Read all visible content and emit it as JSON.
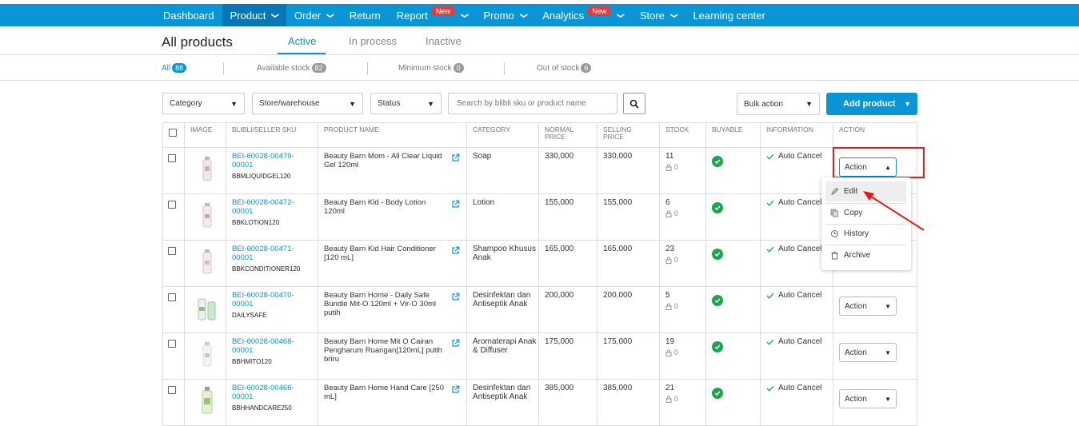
{
  "nav": {
    "items": [
      {
        "label": "Dashboard",
        "active": false,
        "caret": false,
        "badge": ""
      },
      {
        "label": "Product",
        "active": true,
        "caret": true,
        "badge": ""
      },
      {
        "label": "Order",
        "active": false,
        "caret": true,
        "badge": ""
      },
      {
        "label": "Return",
        "active": false,
        "caret": false,
        "badge": ""
      },
      {
        "label": "Report",
        "active": false,
        "caret": true,
        "badge": "New"
      },
      {
        "label": "Promo",
        "active": false,
        "caret": true,
        "badge": ""
      },
      {
        "label": "Analytics",
        "active": false,
        "caret": true,
        "badge": "New"
      },
      {
        "label": "Store",
        "active": false,
        "caret": true,
        "badge": ""
      },
      {
        "label": "Learning center",
        "active": false,
        "caret": false,
        "badge": ""
      }
    ],
    "bg_color": "#0a95d6"
  },
  "page": {
    "title": "All products",
    "tabs": [
      "Active",
      "In process",
      "Inactive"
    ],
    "active_tab": "Active"
  },
  "stock_filters": [
    {
      "label": "All",
      "count": "88"
    },
    {
      "label": "Available stock",
      "count": "82"
    },
    {
      "label": "Minimum stock",
      "count": "0"
    },
    {
      "label": "Out of stock",
      "count": "6"
    }
  ],
  "toolbar": {
    "category": "Category",
    "store_warehouse": "Store/warehouse",
    "status": "Status",
    "search_placeholder": "Search by blibli sku or product name",
    "bulk_action": "Bulk action",
    "add_product": "Add product"
  },
  "table": {
    "headers": [
      "",
      "IMAGE",
      "BLIBLI/SELLER SKU",
      "PRODUCT NAME",
      "CATEGORY",
      "NORMAL PRICE",
      "SELLING PRICE",
      "STOCK",
      "BUYABLE",
      "INFORMATION",
      "ACTION"
    ],
    "rows": [
      {
        "sku": "BEI-60028-00479-00001",
        "seller_sku": "BBMLIQUIDGEL120",
        "name": "Beauty Barn Mom - All Clear Liquid Gel 120ml",
        "category": "Soap",
        "normal_price": "330,000",
        "selling_price": "330,000",
        "stock": "11",
        "locked": "0",
        "information": "Auto Cancel",
        "action": "Action",
        "open": true
      },
      {
        "sku": "BEI-60028-00472-00001",
        "seller_sku": "BBKLOTION120",
        "name": "Beauty Barn Kid - Body Lotion 120ml",
        "category": "Lotion",
        "normal_price": "155,000",
        "selling_price": "155,000",
        "stock": "6",
        "locked": "0",
        "information": "Auto Cancel",
        "action": "Action",
        "open": false
      },
      {
        "sku": "BEI-60028-00471-00001",
        "seller_sku": "BBKCONDITIONER120",
        "name": "Beauty Barn Kid Hair Conditioner [120 mL]",
        "category": "Shampoo Khusus Anak",
        "normal_price": "165,000",
        "selling_price": "165,000",
        "stock": "23",
        "locked": "0",
        "information": "Auto Cancel",
        "action": "Action",
        "open": false
      },
      {
        "sku": "BEI-60028-00470-00001",
        "seller_sku": "DAILYSAFE",
        "name": "Beauty Barn Home - Daily Safe Bundle Mit-O 120ml + Vir-O 30ml putih",
        "category": "Desinfektan dan Antiseptik Anak",
        "normal_price": "200,000",
        "selling_price": "200,000",
        "stock": "5",
        "locked": "0",
        "information": "Auto Cancel",
        "action": "Action",
        "open": false
      },
      {
        "sku": "BEI-60028-00468-00001",
        "seller_sku": "BBHMITO120",
        "name": "Beauty Barn Home Mit O Cairan Pengharum Ruangan[120mL] putih briru",
        "category": "Aromaterapi Anak & Diffuser",
        "normal_price": "175,000",
        "selling_price": "175,000",
        "stock": "19",
        "locked": "0",
        "information": "Auto Cancel",
        "action": "Action",
        "open": false
      },
      {
        "sku": "BEI-60028-00466-00001",
        "seller_sku": "BBHHANDCARE250",
        "name": "Beauty Barn Home Hand Care [250 mL]",
        "category": "Desinfektan dan Antiseptik Anak",
        "normal_price": "385,000",
        "selling_price": "385,000",
        "stock": "21",
        "locked": "0",
        "information": "Auto Cancel",
        "action": "Action",
        "open": false
      }
    ]
  },
  "action_menu": {
    "items": [
      {
        "label": "Edit",
        "icon": "pencil-icon",
        "hover": true
      },
      {
        "label": "Copy",
        "icon": "copy-icon",
        "hover": false
      },
      {
        "label": "History",
        "icon": "history-icon",
        "hover": false
      },
      {
        "label": "Archive",
        "icon": "trash-icon",
        "hover": false
      }
    ]
  },
  "colors": {
    "accent": "#0a95d6",
    "highlight": "#e01b1b",
    "success": "#1aa64f",
    "badge": "#e53b3b"
  }
}
